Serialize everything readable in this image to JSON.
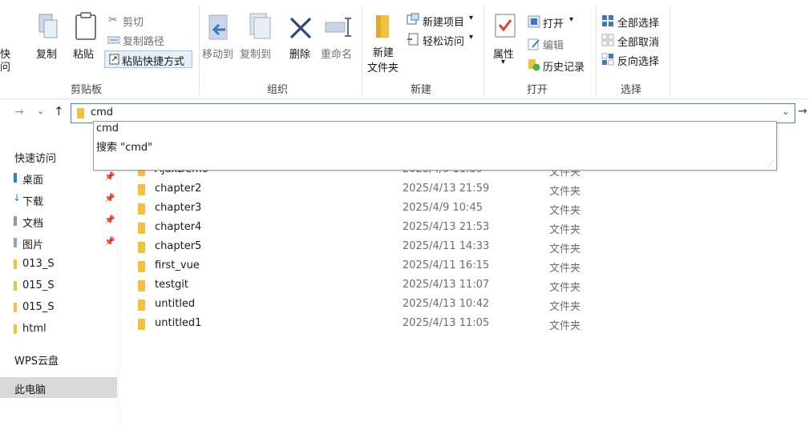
{
  "ribbon": {
    "clipboard": {
      "pin_quick_line1": "快",
      "pin_quick_line2": "问",
      "copy": "复制",
      "paste": "粘贴",
      "cut": "剪切",
      "copy_path": "复制路径",
      "paste_shortcut": "粘贴快捷方式",
      "group": "剪贴板"
    },
    "organize": {
      "move_to": "移动到",
      "copy_to": "复制到",
      "delete": "删除",
      "rename": "重命名",
      "group": "组织"
    },
    "new": {
      "new_folder_line1": "新建",
      "new_folder_line2": "文件夹",
      "new_item": "新建项目",
      "easy_access": "轻松访问",
      "group": "新建"
    },
    "open": {
      "properties": "属性",
      "open": "打开",
      "edit": "编辑",
      "history": "历史记录",
      "group": "打开"
    },
    "select": {
      "select_all": "全部选择",
      "select_none": "全部取消",
      "invert": "反向选择",
      "group": "选择"
    },
    "dropdown_glyph": "▾"
  },
  "address": {
    "value": "cmd",
    "suggestions": [
      "cmd",
      "搜索 \"cmd\""
    ]
  },
  "sidebar": {
    "quick_access": "快速访问",
    "items": [
      {
        "label": "桌面",
        "pinned": true
      },
      {
        "label": "下载",
        "pinned": true
      },
      {
        "label": "文档",
        "pinned": true
      },
      {
        "label": "图片",
        "pinned": true
      },
      {
        "label": "013_S"
      },
      {
        "label": "015_S"
      },
      {
        "label": "015_S"
      },
      {
        "label": "html"
      }
    ],
    "wps": "WPS云盘",
    "this_pc": "此电脑"
  },
  "files": [
    {
      "name": "AjaxDemo",
      "date": "2025/4/9 11:39",
      "type": "文件夹"
    },
    {
      "name": "chapter2",
      "date": "2025/4/13 21:59",
      "type": "文件夹"
    },
    {
      "name": "chapter3",
      "date": "2025/4/9 10:45",
      "type": "文件夹"
    },
    {
      "name": "chapter4",
      "date": "2025/4/13 21:53",
      "type": "文件夹"
    },
    {
      "name": "chapter5",
      "date": "2025/4/11 14:33",
      "type": "文件夹"
    },
    {
      "name": "first_vue",
      "date": "2025/4/11 16:15",
      "type": "文件夹"
    },
    {
      "name": "testgit",
      "date": "2025/4/13 11:07",
      "type": "文件夹"
    },
    {
      "name": "untitled",
      "date": "2025/4/13 10:42",
      "type": "文件夹"
    },
    {
      "name": "untitled1",
      "date": "2025/4/13 11:05",
      "type": "文件夹"
    }
  ],
  "colors": {
    "accent": "#3b86d6",
    "folder": "#f2c13b",
    "selected_bg": "#d9d9d9"
  }
}
